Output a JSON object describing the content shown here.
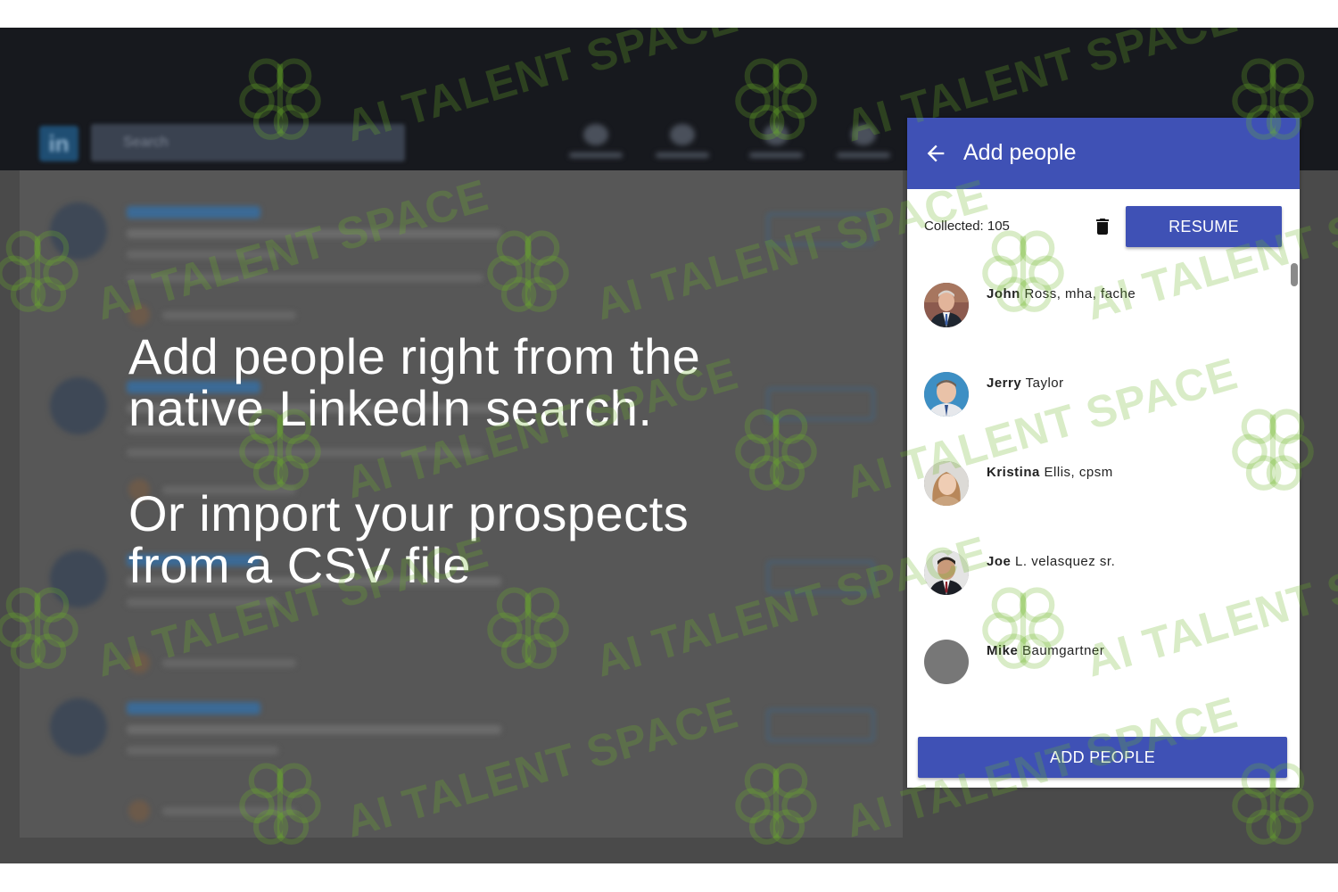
{
  "promo": {
    "line1": "Add people right from the",
    "line2": "native LinkedIn search.",
    "line3": "Or import your prospects",
    "line4": "from a CSV file"
  },
  "watermark": {
    "text": "AI TALENT SPACE"
  },
  "background": {
    "logo_text": "in",
    "search_placeholder": "Search"
  },
  "panel": {
    "title": "Add people",
    "back_icon": "arrow-left-icon",
    "collected_label": "Collected: 105",
    "delete_icon": "trash-icon",
    "resume_label": "RESUME",
    "add_people_label": "ADD PEOPLE",
    "accent_color": "#3f51b5"
  },
  "people": [
    {
      "first": "John",
      "rest": "Ross, mha, fache"
    },
    {
      "first": "Jerry",
      "rest": "Taylor"
    },
    {
      "first": "Kristina",
      "rest": "Ellis, cpsm"
    },
    {
      "first": "Joe",
      "rest": "L. velasquez sr."
    },
    {
      "first": "Mike",
      "rest": "Baumgartner"
    }
  ]
}
